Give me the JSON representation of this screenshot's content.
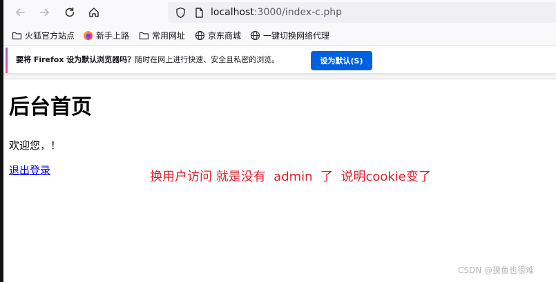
{
  "browser": {
    "url_host": "localhost",
    "url_path": ":3000/index-c.php",
    "nav_icons": [
      "back-arrow-icon",
      "forward-arrow-icon",
      "reload-icon",
      "home-icon"
    ]
  },
  "bookmarks": {
    "items": [
      {
        "label": "火狐官方站点",
        "icon": "folder-icon"
      },
      {
        "label": "新手上路",
        "icon": "firefox-icon"
      },
      {
        "label": "常用网址",
        "icon": "folder-icon"
      },
      {
        "label": "京东商城",
        "icon": "globe-icon"
      },
      {
        "label": "一键切换网络代理",
        "icon": "globe-icon"
      }
    ]
  },
  "notification": {
    "prefix": "要将 ",
    "brand": "Firefox",
    "question": " 设为默认浏览器吗？",
    "message": "随时在网上进行快速、安全且私密的浏览。",
    "button_label": "设为默认(S)",
    "accent_color": "#0061e0"
  },
  "page": {
    "title": "后台首页",
    "welcome": "欢迎您，！",
    "logout_label": "退出登录",
    "link_color": "#0000ee"
  },
  "annotation": {
    "text": "换用户访问 就是没有  admin  了  说明cookie变了",
    "color": "#e0202a"
  },
  "watermark": {
    "text": "CSDN @摸鱼也很难"
  }
}
